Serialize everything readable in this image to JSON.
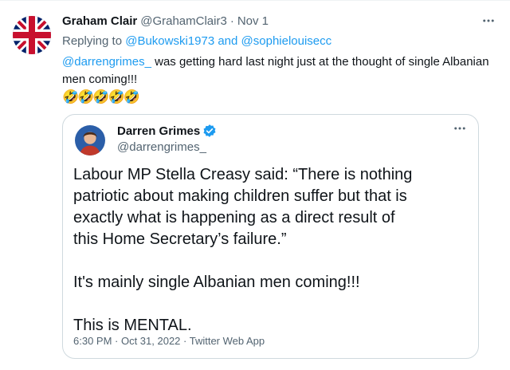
{
  "tweet": {
    "author_name": "Graham Clair",
    "author_handle": "@GrahamClair3",
    "separator": "·",
    "date": "Nov 1",
    "avatar_icon": "union-jack-flag-avatar",
    "replying_prefix": "Replying to ",
    "replying_to": "@Bukowski1973 and @sophielouisecc",
    "mention": "@darrengrimes_",
    "text": " was getting hard last night just at the thought of single Albanian men coming!!!",
    "emojis": "🤣🤣🤣🤣🤣",
    "more_icon": "more-horizontal-icon"
  },
  "quoted": {
    "author_name": "Darren Grimes",
    "author_handle": "@darrengrimes_",
    "verified_icon": "verified-badge-icon",
    "paragraphs": [
      "Labour MP Stella Creasy said: “There is nothing patriotic about making children suffer but that is exactly what is happening as a direct result of this Home Secretary’s failure.”",
      "It's mainly single Albanian men coming!!!",
      "This is MENTAL."
    ],
    "meta": "6:30 PM · Oct 31, 2022 · Twitter Web App"
  },
  "colors": {
    "link": "#1d9bf0",
    "secondary_text": "#536471",
    "border": "#cfd9de"
  }
}
